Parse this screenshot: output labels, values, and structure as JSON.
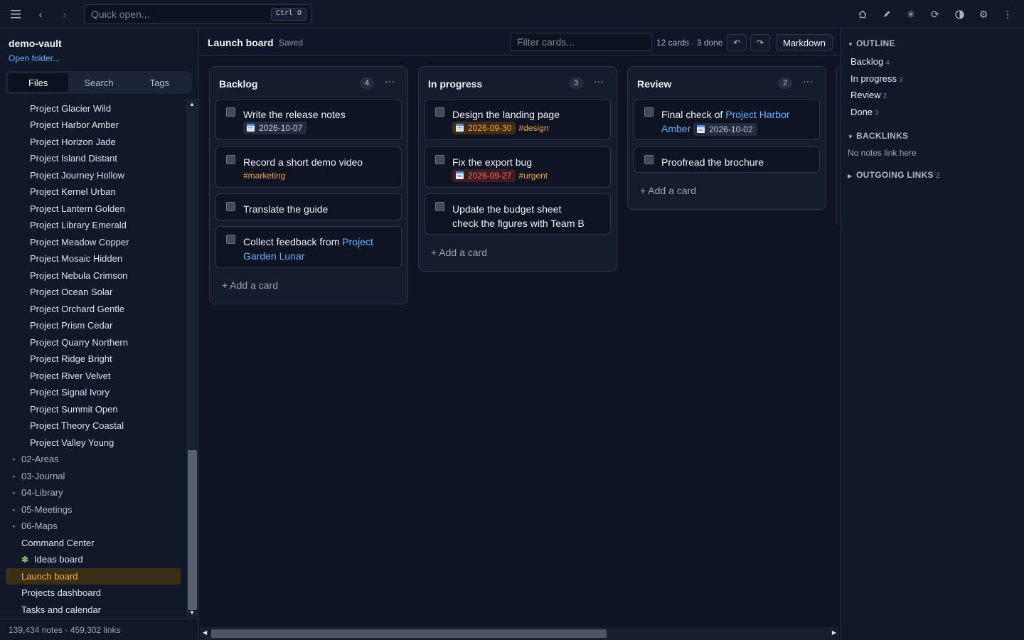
{
  "topbar": {
    "quick_open_placeholder": "Quick open...",
    "quick_open_shortcut": "Ctrl O",
    "icons": [
      "menu-icon",
      "back-icon",
      "forward-icon",
      "home-icon",
      "edit-icon",
      "sparkle-icon",
      "refresh-icon",
      "contrast-icon",
      "gear-icon",
      "more-icon"
    ]
  },
  "sidebar": {
    "vault_name": "demo-vault",
    "open_folder": "Open folder...",
    "tabs": [
      "Files",
      "Search",
      "Tags"
    ],
    "active_tab": "Files",
    "projects": [
      "Project Glacier Wild",
      "Project Harbor Amber",
      "Project Horizon Jade",
      "Project Island Distant",
      "Project Journey Hollow",
      "Project Kernel Urban",
      "Project Lantern Golden",
      "Project Library Emerald",
      "Project Meadow Copper",
      "Project Mosaic Hidden",
      "Project Nebula Crimson",
      "Project Ocean Solar",
      "Project Orchard Gentle",
      "Project Prism Cedar",
      "Project Quarry Northern",
      "Project Ridge Bright",
      "Project River Velvet",
      "Project Signal Ivory",
      "Project Summit Open",
      "Project Theory Coastal",
      "Project Valley Young"
    ],
    "folders": [
      "02-Areas",
      "03-Journal",
      "04-Library",
      "05-Meetings",
      "06-Maps"
    ],
    "root_files": [
      "Command Center",
      "Ideas board",
      "Launch board",
      "Projects dashboard",
      "Tasks and calendar"
    ],
    "selected": "Launch board",
    "footer": "139,434 notes · 459,302 links"
  },
  "header": {
    "title": "Launch board",
    "status": "Saved",
    "filter_placeholder": "Filter cards...",
    "card_count": "12 cards · 3 done",
    "undo_label": "↶",
    "redo_label": "↷",
    "markdown_label": "Markdown"
  },
  "board": {
    "add_card_label": "+ Add a card",
    "columns": [
      {
        "title": "Backlog",
        "count": "4",
        "cards": [
          {
            "text": "Write the release notes",
            "date": "2026-10-07",
            "date_state": "normal"
          },
          {
            "text": "Record a short demo video",
            "tag": "#marketing"
          },
          {
            "text": "Translate the guide"
          },
          {
            "text_before": "Collect feedback from ",
            "link": "Project Garden Lunar"
          }
        ]
      },
      {
        "title": "In progress",
        "count": "3",
        "cards": [
          {
            "text": "Design the landing page",
            "date": "2026-09-30",
            "date_state": "soon",
            "tag": "#design"
          },
          {
            "text": "Fix the export bug",
            "date": "2026-09-27",
            "date_state": "overdue",
            "tag": "#urgent"
          },
          {
            "text": "Update the budget sheet",
            "subtext": "check the figures with Team B"
          }
        ]
      },
      {
        "title": "Review",
        "count": "2",
        "cards": [
          {
            "text_before": "Final check of ",
            "link": "Project Harbor Amber",
            "date": "2026-10-02",
            "date_state": "normal"
          },
          {
            "text": "Proofread the brochure"
          }
        ]
      }
    ]
  },
  "right_panel": {
    "outline_title": "OUTLINE",
    "outline": [
      {
        "label": "Backlog",
        "count": "4"
      },
      {
        "label": "In progress",
        "count": "3"
      },
      {
        "label": "Review",
        "count": "2"
      },
      {
        "label": "Done",
        "count": "3"
      }
    ],
    "backlinks_title": "BACKLINKS",
    "backlinks_empty": "No notes link here",
    "outgoing_title": "OUTGOING LINKS",
    "outgoing_count": "2"
  },
  "colors": {
    "background": "#0f1424",
    "accent_link": "#6ab0ff",
    "selected_file": "#f2b540",
    "tag": "#f2a33a",
    "overdue": "#f56b74"
  }
}
